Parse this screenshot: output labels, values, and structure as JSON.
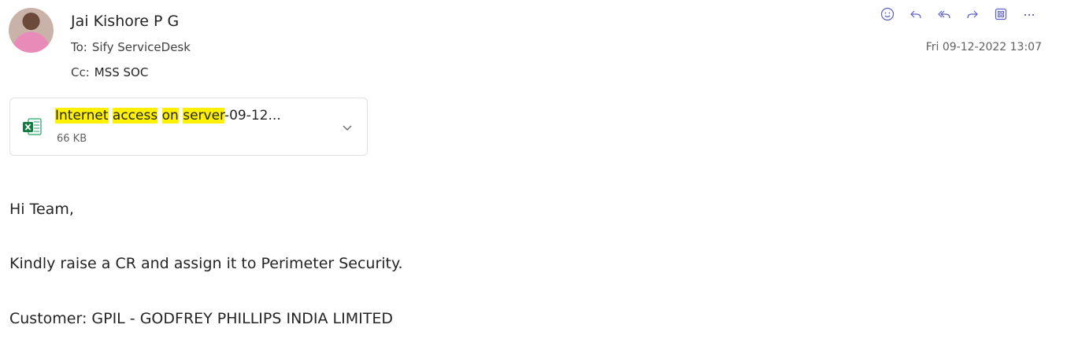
{
  "header": {
    "sender": "Jai Kishore P G",
    "to_label": "To:",
    "to_value": "Sify ServiceDesk",
    "cc_label": "Cc:",
    "cc_value": "MSS SOC",
    "date": "Fri 09-12-2022 13:07"
  },
  "actions": [
    "smiley-icon",
    "reply-icon",
    "reply-all-icon",
    "forward-icon",
    "apps-icon",
    "more-icon"
  ],
  "attachment": {
    "name_parts": [
      {
        "text": "Internet",
        "highlight": true
      },
      {
        "text": " ",
        "highlight": false
      },
      {
        "text": "access",
        "highlight": true
      },
      {
        "text": " ",
        "highlight": false
      },
      {
        "text": "on",
        "highlight": true
      },
      {
        "text": " ",
        "highlight": false
      },
      {
        "text": "server",
        "highlight": true
      },
      {
        "text": "-09-12...",
        "highlight": false
      }
    ],
    "size": "66 KB",
    "icon": "excel-file-icon",
    "highlight_color": "#fff100"
  },
  "body": {
    "greeting": "Hi Team,",
    "line1": "Kindly raise a CR and assign it to Perimeter Security.",
    "line2": "Customer: GPIL - GODFREY PHILLIPS INDIA LIMITED"
  }
}
